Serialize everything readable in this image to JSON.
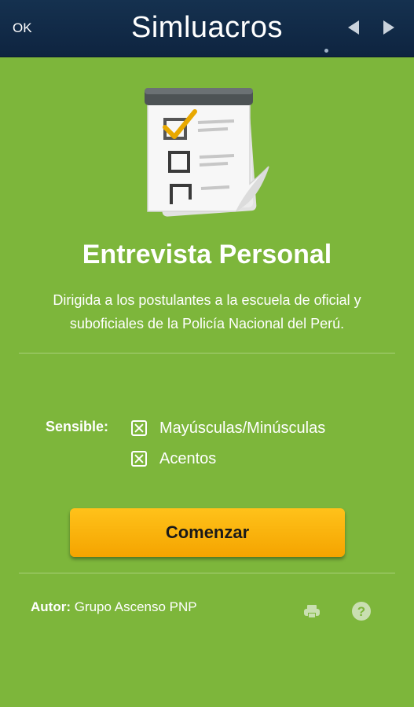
{
  "header": {
    "ok_label": "OK",
    "title": "Simluacros",
    "prev_icon": "chevron-left-icon",
    "next_icon": "chevron-right-icon"
  },
  "main": {
    "icon": "checklist-notepad-icon",
    "title": "Entrevista Personal",
    "description": "Dirigida a los postulantes a la escuela de oficial y suboficiales de la Policía Nacional del Perú."
  },
  "options": {
    "label": "Sensible:",
    "items": [
      {
        "label": "Mayúsculas/Minúsculas",
        "checked": true
      },
      {
        "label": "Acentos",
        "checked": true
      }
    ]
  },
  "start_button": {
    "label": "Comenzar"
  },
  "footer": {
    "author_key": "Autor:",
    "author_value": "Grupo Ascenso PNP",
    "print_icon": "print-icon",
    "help_icon": "help-icon"
  },
  "colors": {
    "background": "#7db63b",
    "header": "#15314f",
    "button": "#f5a400",
    "text": "#ffffff"
  }
}
